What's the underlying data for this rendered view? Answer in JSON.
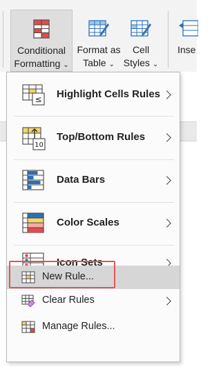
{
  "ribbon": {
    "conditional_formatting": {
      "line1": "Conditional",
      "line2": "Formatting"
    },
    "format_as_table": {
      "line1": "Format as",
      "line2": "Table"
    },
    "cell_styles": {
      "line1": "Cell",
      "line2": "Styles"
    },
    "insert": {
      "line1": "Inse"
    }
  },
  "menu": {
    "highlight_cells_rules": "Highlight Cells Rules",
    "top_bottom_rules": "Top/Bottom Rules",
    "data_bars": "Data Bars",
    "color_scales": "Color Scales",
    "icon_sets": "Icon Sets",
    "new_rule": "New Rule...",
    "clear_rules": "Clear Rules",
    "manage_rules": "Manage Rules..."
  },
  "icons": {
    "highlight_glyph": "≤",
    "top_bottom_glyph": "10"
  },
  "colors": {
    "highlight_outline": "#e05555",
    "selected_bg": "#d6d6d6",
    "icon_blue": "#2a6fba",
    "icon_red": "#e24b4b",
    "icon_yellow": "#f6d46a"
  }
}
